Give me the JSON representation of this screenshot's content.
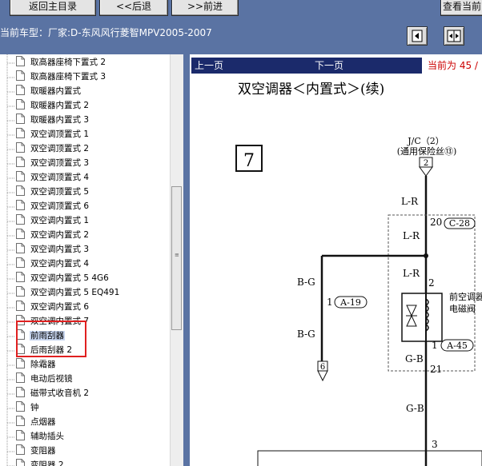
{
  "toolbar": {
    "back_to_index": "返回主目录",
    "back": "<<后退",
    "forward": ">>前进",
    "view_current": "查看当前"
  },
  "vehicle_info": "当前车型：厂家:D-东风风行菱智MPV2005-2007",
  "tree": {
    "items": [
      "取高器座椅下置式 2",
      "取高器座椅下置式 3",
      "取暖器内置式",
      "取暖器内置式 2",
      "取暖器内置式 3",
      "双空调顶置式 1",
      "双空调顶置式 2",
      "双空调顶置式 3",
      "双空调顶置式 4",
      "双空调顶置式 5",
      "双空调顶置式 6",
      "双空调内置式 1",
      "双空调内置式 2",
      "双空调内置式 3",
      "双空调内置式 4",
      "双空调内置式 5 4G6",
      "双空调内置式 5 EQ491",
      "双空调内置式 6",
      "双空调内置式 7",
      "前雨刮器",
      "后雨刮器 2",
      "除霜器",
      "电动后视镜",
      "磁带式收音机 2",
      "钟",
      "点烟器",
      "辅助插头",
      "变阻器",
      "变阻器 2"
    ],
    "selected_index": 19
  },
  "nav": {
    "prev": "上一页",
    "next": "下一页",
    "current": "当前为 45 /"
  },
  "diagram": {
    "title": "双空调器＜内置式＞(续)",
    "section_number": "7",
    "jc_label": "J/C（2）",
    "fuse_label": "(通用保险丝⑬)",
    "pin_j2": "2",
    "wire_lr_1": "L-R",
    "pin_20": "20",
    "conn_c28": "C-28",
    "wire_lr_2": "L-R",
    "wire_lr_3": "L-R",
    "pin_2": "2",
    "solenoid_label_1": "前空调器",
    "solenoid_label_2": "电磁阀",
    "wire_bg_1": "B-G",
    "pin_1a": "1",
    "conn_a19": "A-19",
    "wire_bg_2": "B-G",
    "pin_1b": "1",
    "conn_a45": "A-45",
    "wire_gb_1": "G-B",
    "pin_21": "21",
    "ground_6": "6",
    "wire_gb_2": "G-B",
    "pin_3": "3"
  }
}
